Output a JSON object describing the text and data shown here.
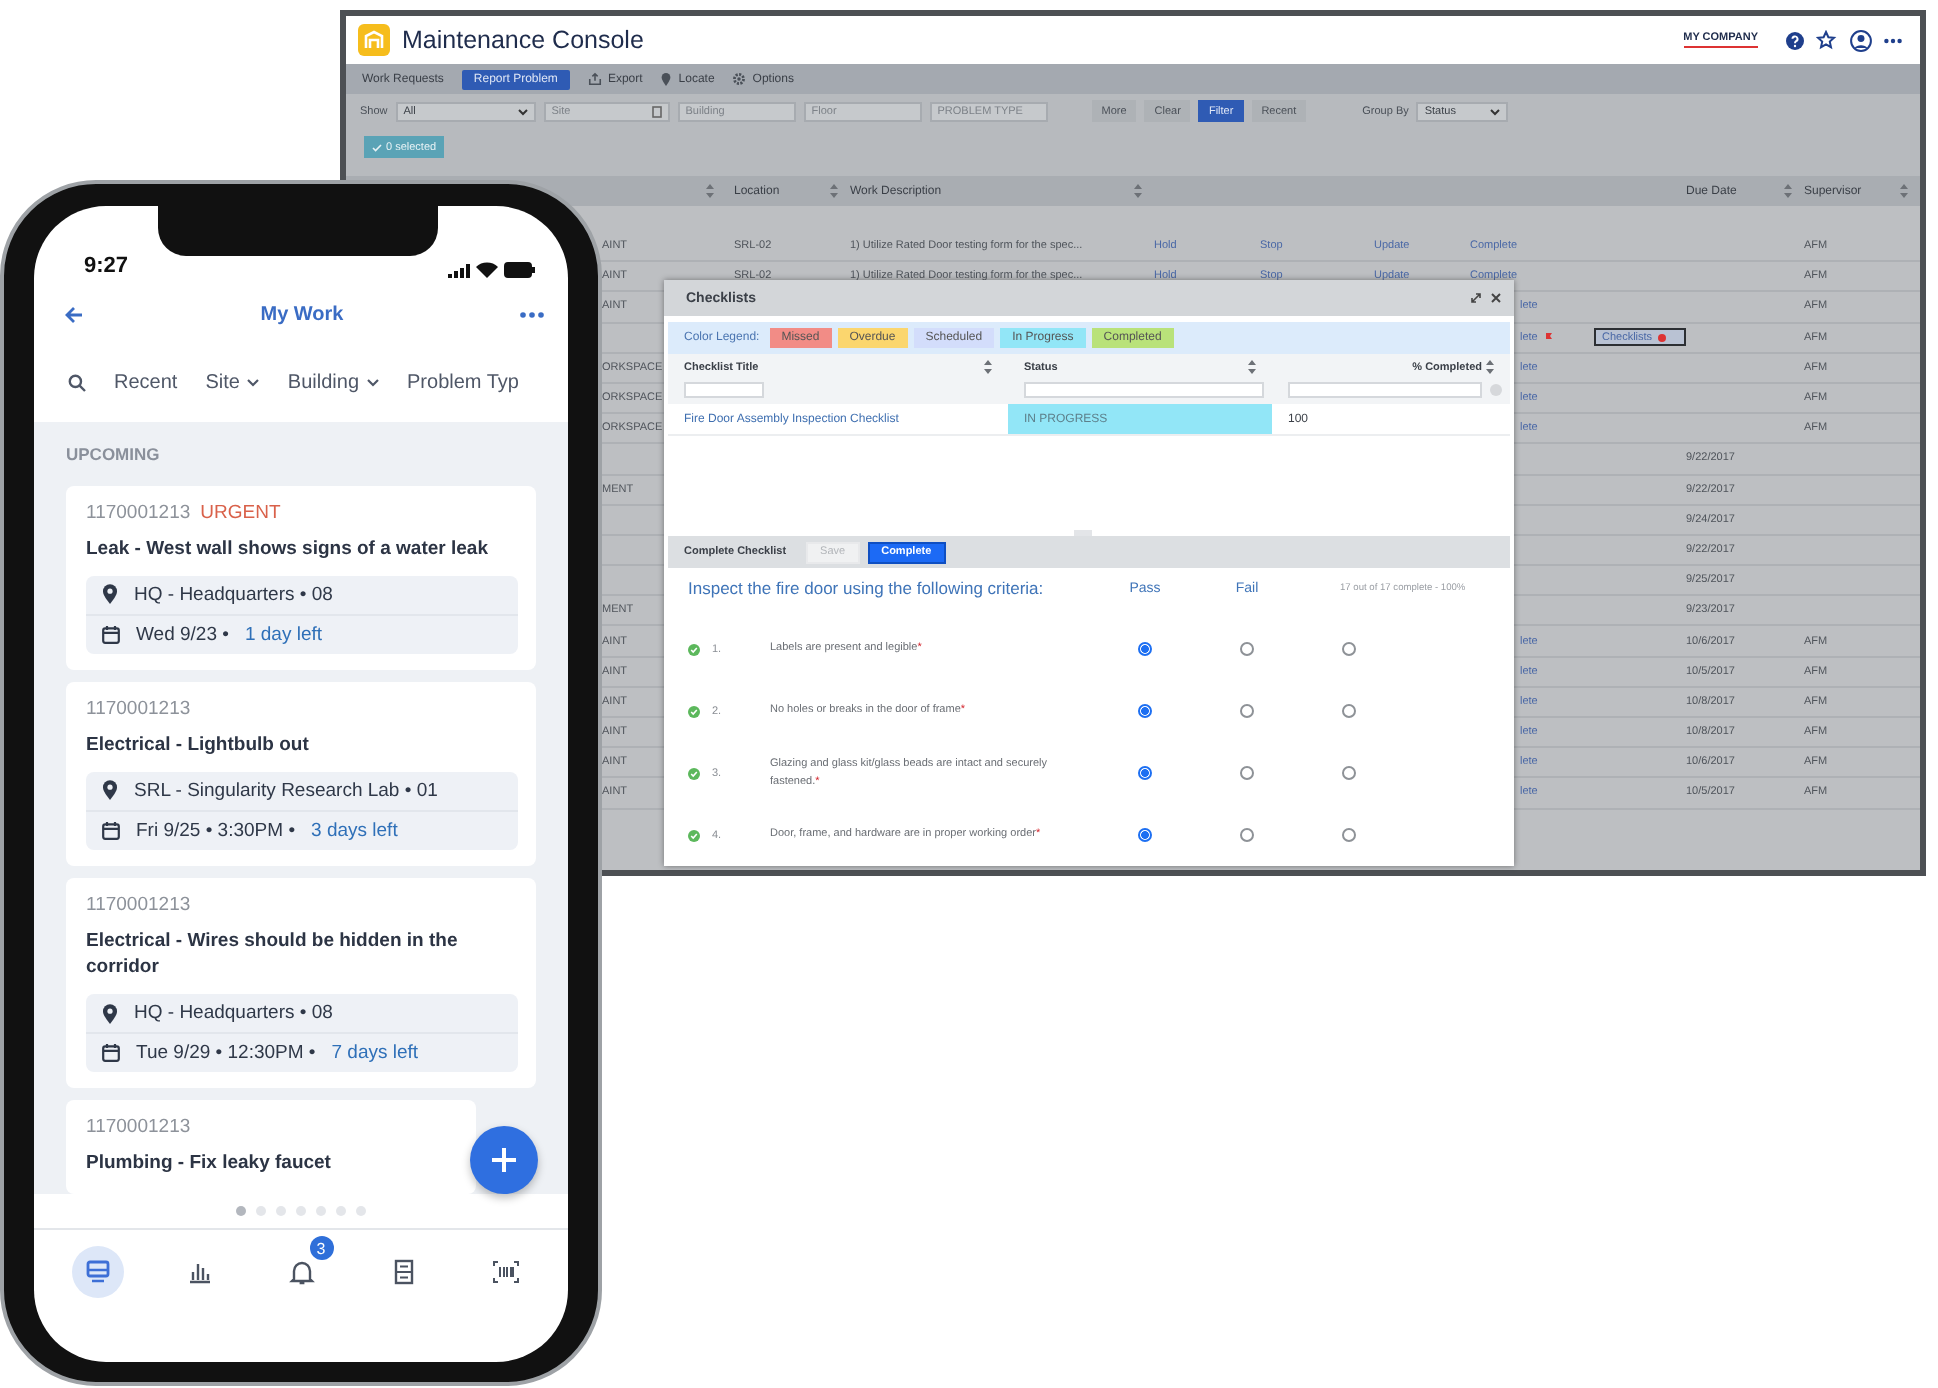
{
  "console": {
    "title": "Maintenance Console",
    "company": "MY COMPANY",
    "section": "Work Requests",
    "report_button": "Report Problem",
    "actions": [
      "Export",
      "Locate",
      "Options"
    ],
    "show": {
      "label": "Show",
      "value": "All"
    },
    "filter_fields": [
      {
        "placeholder": "Site",
        "kind": "lookup"
      },
      {
        "placeholder": "Building",
        "kind": "text"
      },
      {
        "placeholder": "Floor",
        "kind": "text"
      },
      {
        "placeholder": "PROBLEM TYPE",
        "kind": "text"
      }
    ],
    "filter_buttons": [
      {
        "label": "More",
        "selected": false
      },
      {
        "label": "Clear",
        "selected": false
      },
      {
        "label": "Filter",
        "selected": true
      },
      {
        "label": "Recent",
        "selected": false
      }
    ],
    "group_by": {
      "label": "Group By",
      "value": "Status"
    },
    "selection": "0 selected",
    "columns": [
      "Location",
      "Work Description",
      "Due Date",
      "Supervisor"
    ],
    "rows": [
      {
        "column_1": "AINT",
        "location": "SRL-02",
        "description": "1) Utilize Rated Door testing form for the spec...",
        "actions": [
          "Hold",
          "Stop",
          "Update",
          "Complete"
        ],
        "alert": false,
        "supervisor": "AFM"
      },
      {
        "column_1": "AINT",
        "location": "SRL-02",
        "description": "1) Utilize Rated Door testing form for the spec...",
        "actions": [
          "Hold",
          "Stop",
          "Update",
          "Complete"
        ],
        "alert": false,
        "supervisor": "AFM"
      },
      {
        "column_1": "AINT",
        "action_fragment": "lete",
        "alert": false,
        "supervisor": "AFM"
      },
      {
        "action_fragment": "lete",
        "alert": true,
        "checklists": "Checklists",
        "supervisor": "AFM"
      },
      {
        "column_1": "ORKSPACE",
        "action_fragment": "lete",
        "alert": false,
        "supervisor": "AFM"
      },
      {
        "column_1": "ORKSPACE",
        "action_fragment": "lete",
        "alert": false,
        "supervisor": "AFM"
      },
      {
        "column_1": "ORKSPACE",
        "action_fragment": "lete",
        "alert": false,
        "supervisor": "AFM"
      },
      {
        "alert": false,
        "due_date": "9/22/2017"
      },
      {
        "column_1": "MENT",
        "alert": false,
        "due_date": "9/22/2017"
      },
      {
        "alert": false,
        "due_date": "9/24/2017"
      },
      {
        "alert": false,
        "due_date": "9/22/2017"
      },
      {
        "alert": false,
        "due_date": "9/25/2017"
      },
      {
        "column_1": "MENT",
        "alert": false,
        "due_date": "9/23/2017"
      },
      {
        "column_1": "AINT",
        "action_fragment": "lete",
        "alert": false,
        "due_date": "10/6/2017",
        "supervisor": "AFM"
      },
      {
        "column_1": "AINT",
        "action_fragment": "lete",
        "alert": false,
        "due_date": "10/5/2017",
        "supervisor": "AFM"
      },
      {
        "column_1": "AINT",
        "action_fragment": "lete",
        "alert": false,
        "due_date": "10/8/2017",
        "supervisor": "AFM"
      },
      {
        "column_1": "AINT",
        "action_fragment": "lete",
        "alert": false,
        "due_date": "10/8/2017",
        "supervisor": "AFM"
      },
      {
        "column_1": "AINT",
        "action_fragment": "lete",
        "alert": false,
        "due_date": "10/6/2017",
        "supervisor": "AFM"
      },
      {
        "column_1": "AINT",
        "action_fragment": "lete",
        "alert": false,
        "due_date": "10/5/2017",
        "supervisor": "AFM"
      }
    ]
  },
  "checklists_dialog": {
    "title": "Checklists",
    "legend_label": "Color Legend:",
    "legend": [
      {
        "label": "Missed",
        "color": "#f28c86"
      },
      {
        "label": "Overdue",
        "color": "#fbd66e"
      },
      {
        "label": "Scheduled",
        "color": "#d3ddfb"
      },
      {
        "label": "In Progress",
        "color": "#92e6f7"
      },
      {
        "label": "Completed",
        "color": "#b9e27a"
      }
    ],
    "columns": [
      "Checklist Title",
      "Status",
      "% Completed"
    ],
    "rows": [
      {
        "title": "Fire Door Assembly Inspection Checklist",
        "status": "IN PROGRESS",
        "color": "#92e6f7",
        "percent": "100"
      }
    ],
    "section": "Complete Checklist",
    "buttons": [
      {
        "label": "Save",
        "disabled": true
      },
      {
        "label": "Complete",
        "disabled": false
      }
    ],
    "instruction": "Inspect the fire door using the following criteria:",
    "choices": [
      "Pass",
      "Fail"
    ],
    "progress": "17 out of 17 complete - 100%",
    "items": [
      {
        "done": true,
        "number": "1.",
        "text": "Labels are present and legible",
        "mark": "*",
        "options": [
          {
            "selected": true
          },
          {
            "selected": false
          },
          {
            "selected": false
          }
        ]
      },
      {
        "done": true,
        "number": "2.",
        "text": "No holes or breaks in the door of frame",
        "mark": "*",
        "options": [
          {
            "selected": true
          },
          {
            "selected": false
          },
          {
            "selected": false
          }
        ]
      },
      {
        "done": true,
        "number": "3.",
        "text": "Glazing and glass kit/glass beads are intact and securely fastened.",
        "mark": "*",
        "options": [
          {
            "selected": true
          },
          {
            "selected": false
          },
          {
            "selected": false
          }
        ]
      },
      {
        "done": true,
        "number": "4.",
        "text": "Door, frame, and hardware are in proper working order",
        "mark": "*",
        "options": [
          {
            "selected": true
          },
          {
            "selected": false
          },
          {
            "selected": false
          }
        ]
      }
    ]
  },
  "phone": {
    "time": "9:27",
    "title": "My Work",
    "filters": [
      {
        "label": "Recent",
        "dropdown": false
      },
      {
        "label": "Site",
        "dropdown": true
      },
      {
        "label": "Building",
        "dropdown": true
      },
      {
        "label": "Problem Typ",
        "dropdown": false
      }
    ],
    "section": "UPCOMING",
    "cards": [
      {
        "id": "1170001213",
        "priority": "URGENT",
        "title": "Leak - West wall shows signs of a water leak",
        "place": "HQ - Headquarters • 08",
        "schedule": "Wed 9/23 •",
        "remaining": "1 day left"
      },
      {
        "id": "1170001213",
        "title": "Electrical - Lightbulb out",
        "place": "SRL - Singularity Research Lab • 01",
        "schedule": "Fri 9/25 • 3:30PM •",
        "remaining": "3 days left"
      },
      {
        "id": "1170001213",
        "title": "Electrical - Wires should be hidden in the corridor",
        "place": "HQ - Headquarters • 08",
        "schedule": "Tue 9/29 • 12:30PM •",
        "remaining": "7 days left"
      },
      {
        "id": "1170001213",
        "title": "Plumbing - Fix leaky faucet"
      }
    ],
    "pages": [
      {
        "selected": true
      },
      {
        "selected": false
      },
      {
        "selected": false
      },
      {
        "selected": false
      },
      {
        "selected": false
      },
      {
        "selected": false
      },
      {
        "selected": false
      }
    ],
    "nav": [
      {
        "selected": true
      },
      {
        "selected": false
      },
      {
        "selected": false,
        "badge": "3"
      },
      {
        "selected": false
      },
      {
        "selected": false
      }
    ]
  }
}
